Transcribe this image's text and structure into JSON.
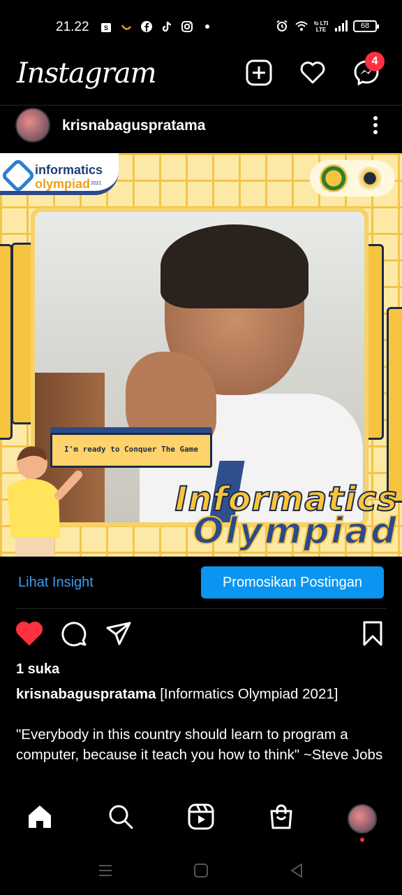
{
  "status_bar": {
    "time": "21.22",
    "left_icons": [
      "shopee-icon",
      "swoosh-icon",
      "facebook-icon",
      "tiktok-icon",
      "instagram-icon",
      "dot-icon"
    ],
    "right_icons": [
      "alarm-icon",
      "wifi-icon",
      "volte-icon",
      "signal-icon"
    ],
    "volte_label": "Vo LTE",
    "battery": "68"
  },
  "header": {
    "logo": "Instagram",
    "messenger_badge": "4"
  },
  "post": {
    "username": "krisnabaguspratama",
    "image": {
      "logo_line1": "informatics",
      "logo_line2": "olympiad",
      "logo_year": "2021",
      "tag_text": "I'm ready to Conquer The Game",
      "title_line1": "Informatics",
      "title_line2": "Olympiad"
    },
    "insight_label": "Lihat Insight",
    "promote_label": "Promosikan Postingan",
    "likes": "1 suka",
    "caption_user": "krisnabaguspratama",
    "caption_title": " [Informatics Olympiad 2021]",
    "caption_body": "\"Everybody in this country should learn to program a computer, because it teach you how to think\" ~Steve Jobs"
  },
  "colors": {
    "background": "#000000",
    "link_blue": "#3d9df0",
    "button_blue": "#0b95f0",
    "like_red": "#ff3040",
    "badge_red": "#ff3040"
  }
}
